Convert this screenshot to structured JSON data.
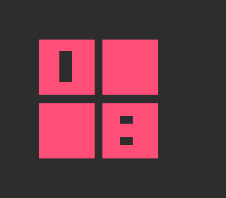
{
  "icon": {
    "name": "four-square-grid-glyph",
    "colors": {
      "background": "#2d2d2d",
      "tile": "#ff4f79",
      "cutout": "#2d2d2d"
    }
  }
}
